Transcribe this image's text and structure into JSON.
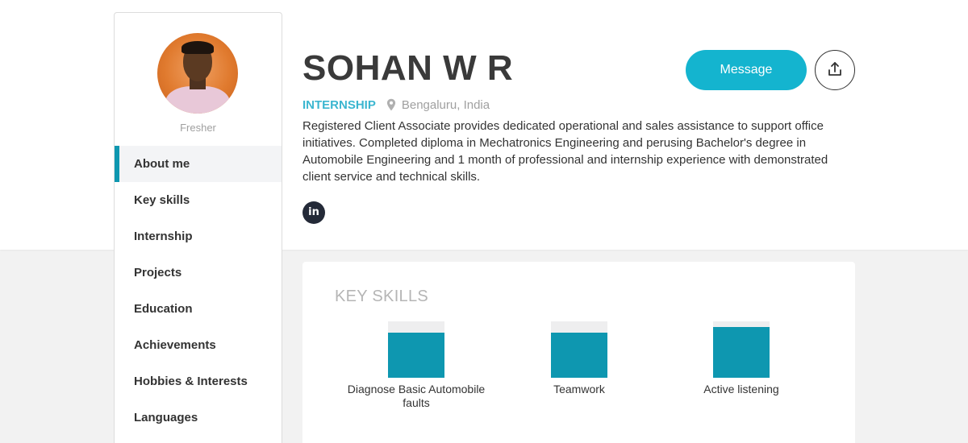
{
  "profile": {
    "level": "Fresher",
    "name": "SOHAN W R",
    "type": "INTERNSHIP",
    "location": "Bengaluru, India",
    "bio": "Registered Client Associate provides dedicated operational and sales assistance to support office initiatives. Completed diploma in Mechatronics Engineering and perusing Bachelor's degree in Automobile Engineering and 1 month of professional and internship experience with demonstrated client service and technical skills.",
    "linkedin_label": "in"
  },
  "actions": {
    "message_label": "Message",
    "share_icon": "share-icon"
  },
  "sidebar": {
    "items": [
      {
        "label": "About me",
        "active": true
      },
      {
        "label": "Key skills"
      },
      {
        "label": "Internship"
      },
      {
        "label": "Projects"
      },
      {
        "label": "Education"
      },
      {
        "label": "Achievements"
      },
      {
        "label": "Hobbies & Interests"
      },
      {
        "label": "Languages"
      }
    ]
  },
  "key_skills": {
    "title": "KEY SKILLS",
    "skills": [
      {
        "label": "Diagnose Basic Automobile faults",
        "level": 0.8
      },
      {
        "label": "Teamwork",
        "level": 0.8
      },
      {
        "label": "Active listening",
        "level": 0.9
      }
    ]
  },
  "colors": {
    "accent": "#0e97b0",
    "message_button": "#14b4cf",
    "type_label": "#3bb6d0"
  }
}
